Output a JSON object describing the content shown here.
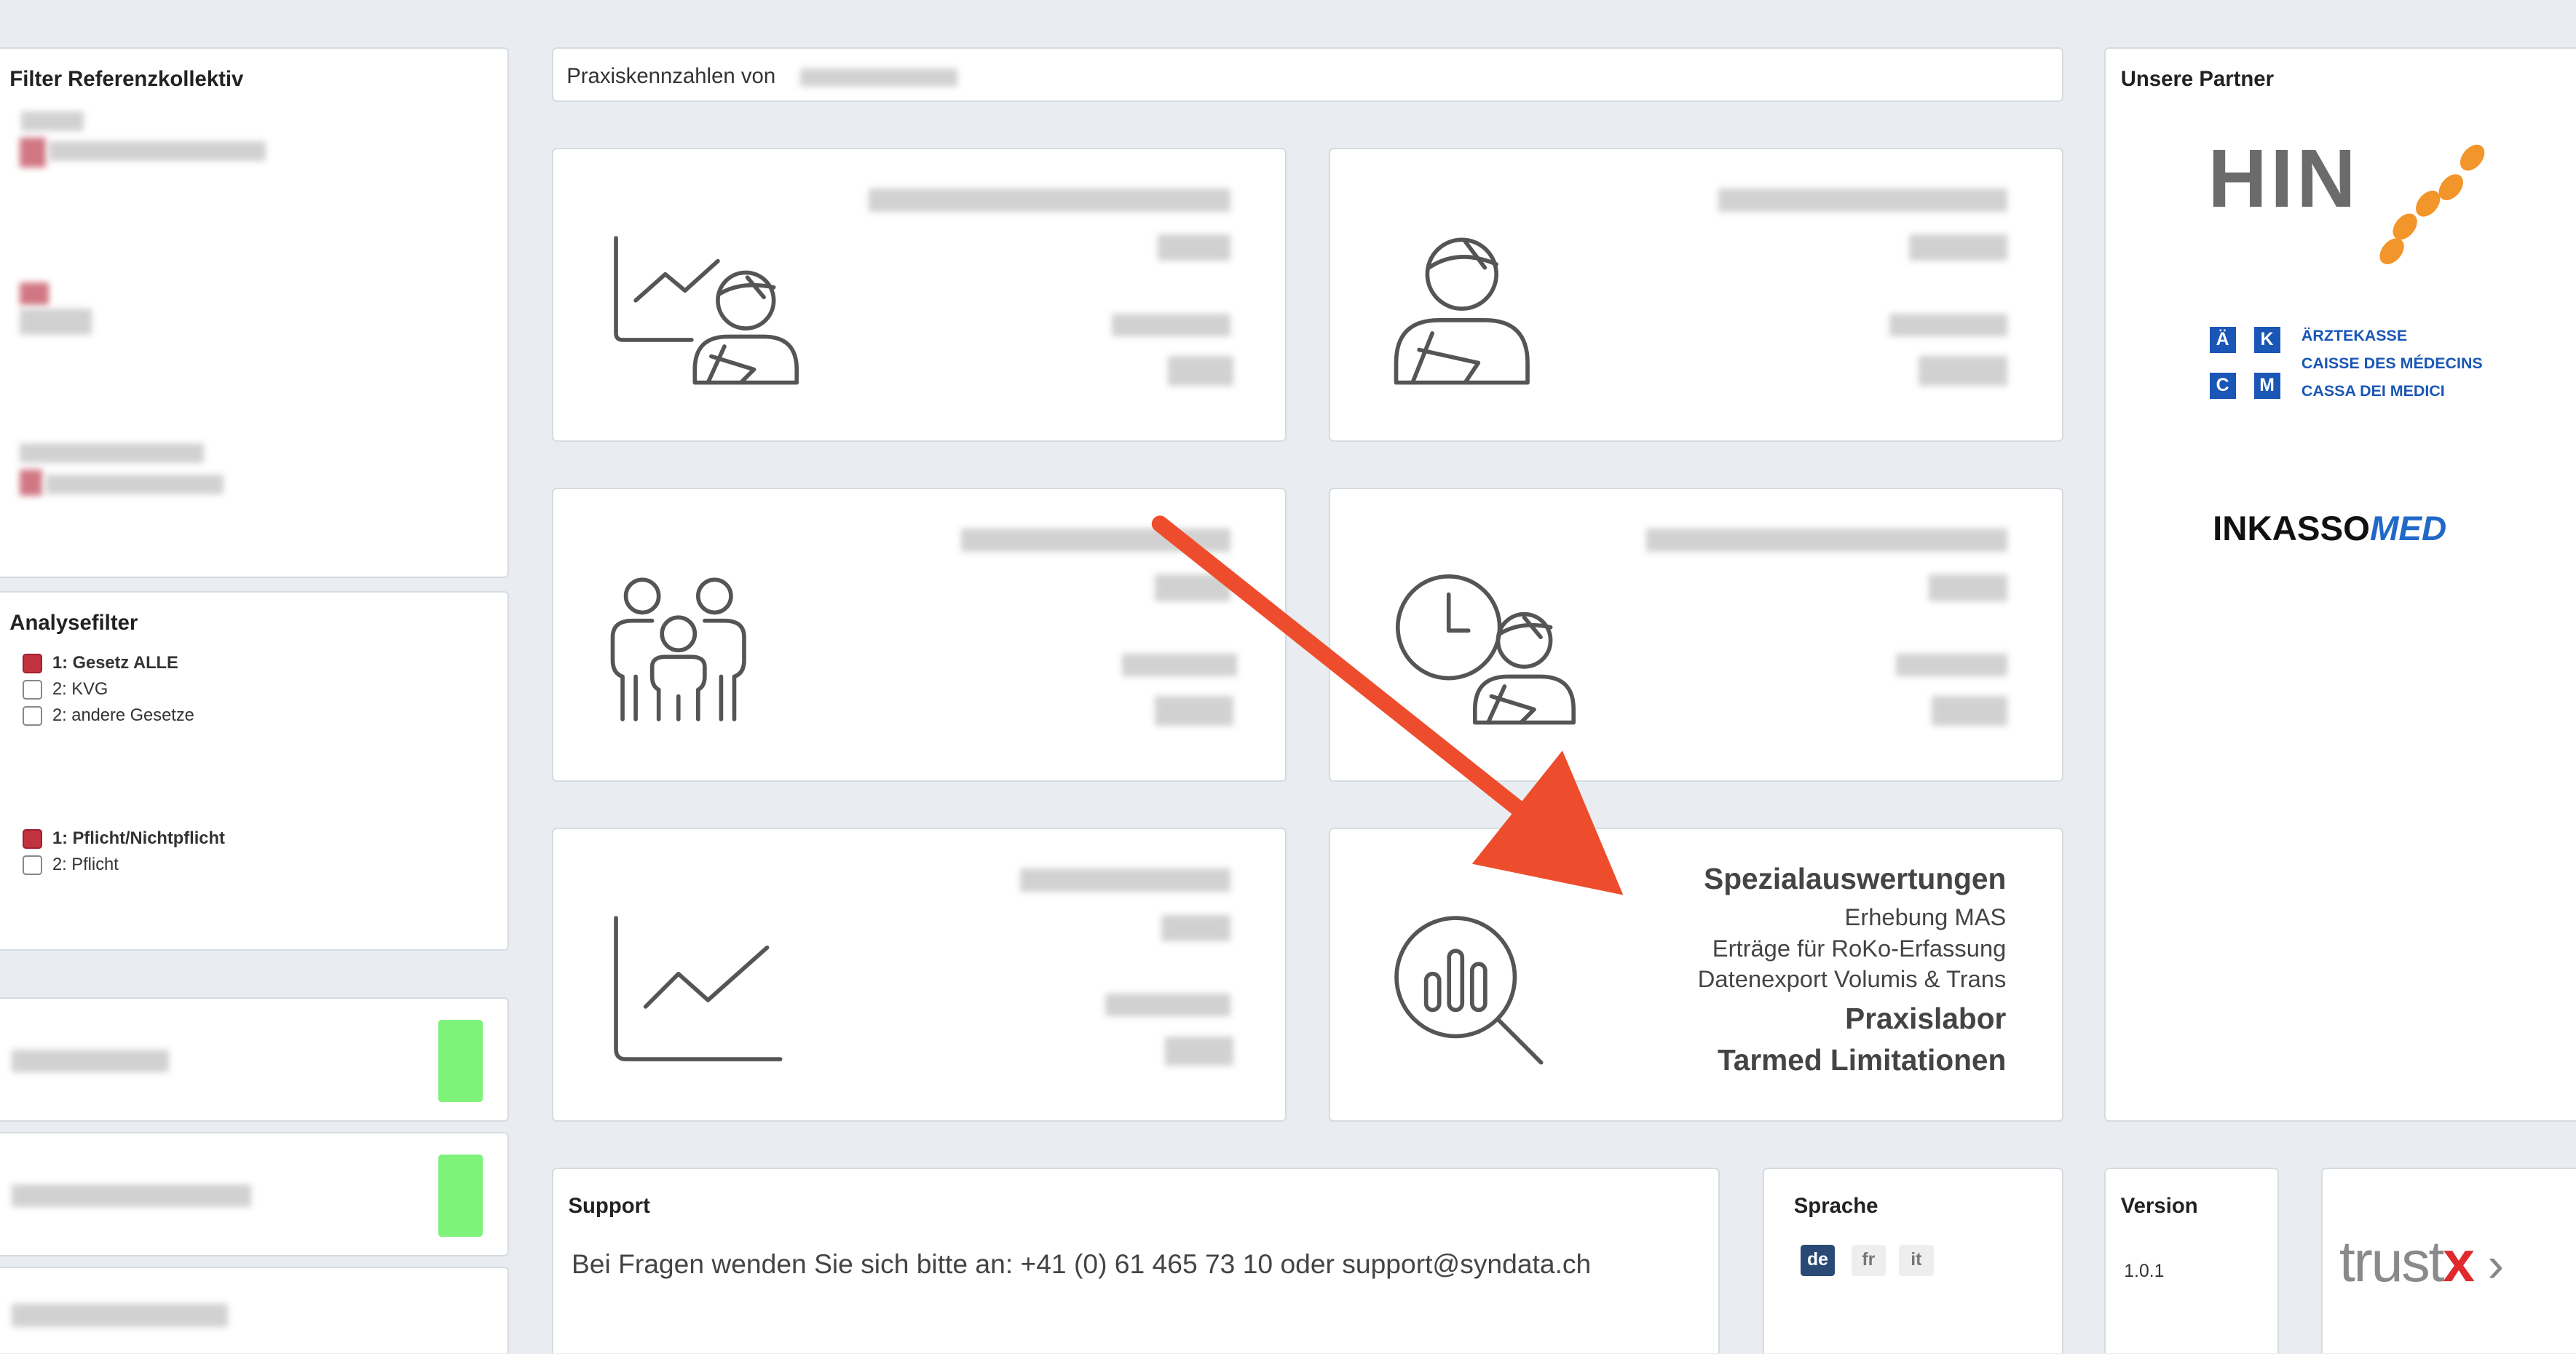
{
  "sidebar": {
    "filter_title": "Filter Referenzkollektiv",
    "analyse_title": "Analysefilter",
    "gesetz_options": [
      {
        "label": "1: Gesetz ALLE",
        "checked": true
      },
      {
        "label": "2: KVG",
        "checked": false
      },
      {
        "label": "2: andere Gesetze",
        "checked": false
      }
    ],
    "pflicht_options": [
      {
        "label": "1: Pflicht/Nichtpflicht",
        "checked": true
      },
      {
        "label": "2: Pflicht",
        "checked": false
      }
    ]
  },
  "header": {
    "title": "Praxiskennzahlen von"
  },
  "tiles": [
    {
      "icon": "chart-patient-icon"
    },
    {
      "icon": "patient-icon"
    },
    {
      "icon": "family-icon"
    },
    {
      "icon": "clock-patient-icon"
    },
    {
      "icon": "line-chart-icon"
    },
    {
      "icon": "analysis-search-icon"
    }
  ],
  "special": {
    "title": "Spezialauswertungen",
    "items": [
      "Erhebung MAS",
      "Erträge für RoKo-Erfassung",
      "Datenexport Volumis & Trans"
    ],
    "praxislabor": "Praxislabor",
    "tarmed": "Tarmed Limitationen"
  },
  "partners": {
    "title": "Unsere Partner",
    "hin": "HIN",
    "aekcm_letters": [
      "Ä",
      "K",
      "C",
      "M"
    ],
    "aekcm_lines": [
      "ÄRZTEKASSE",
      "CAISSE DES MÉDECINS",
      "CASSA DEI MEDICI"
    ],
    "inkasso": "INKASSO",
    "med": "MED"
  },
  "support": {
    "title": "Support",
    "text": "Bei Fragen wenden Sie sich bitte an: +41 (0) 61 465 73 10 oder support@syndata.ch"
  },
  "language": {
    "title": "Sprache",
    "options": [
      "de",
      "fr",
      "it"
    ],
    "active": "de"
  },
  "version": {
    "title": "Version",
    "value": "1.0.1"
  },
  "trustx": {
    "trust": "trust",
    "x": "x",
    "chevron": "›"
  },
  "colors": {
    "arrow": "#ee4d2d",
    "accent_red": "#c0333f",
    "green": "#7ff27b",
    "navy": "#2a4a75",
    "aekcm_blue": "#1a56b5"
  }
}
